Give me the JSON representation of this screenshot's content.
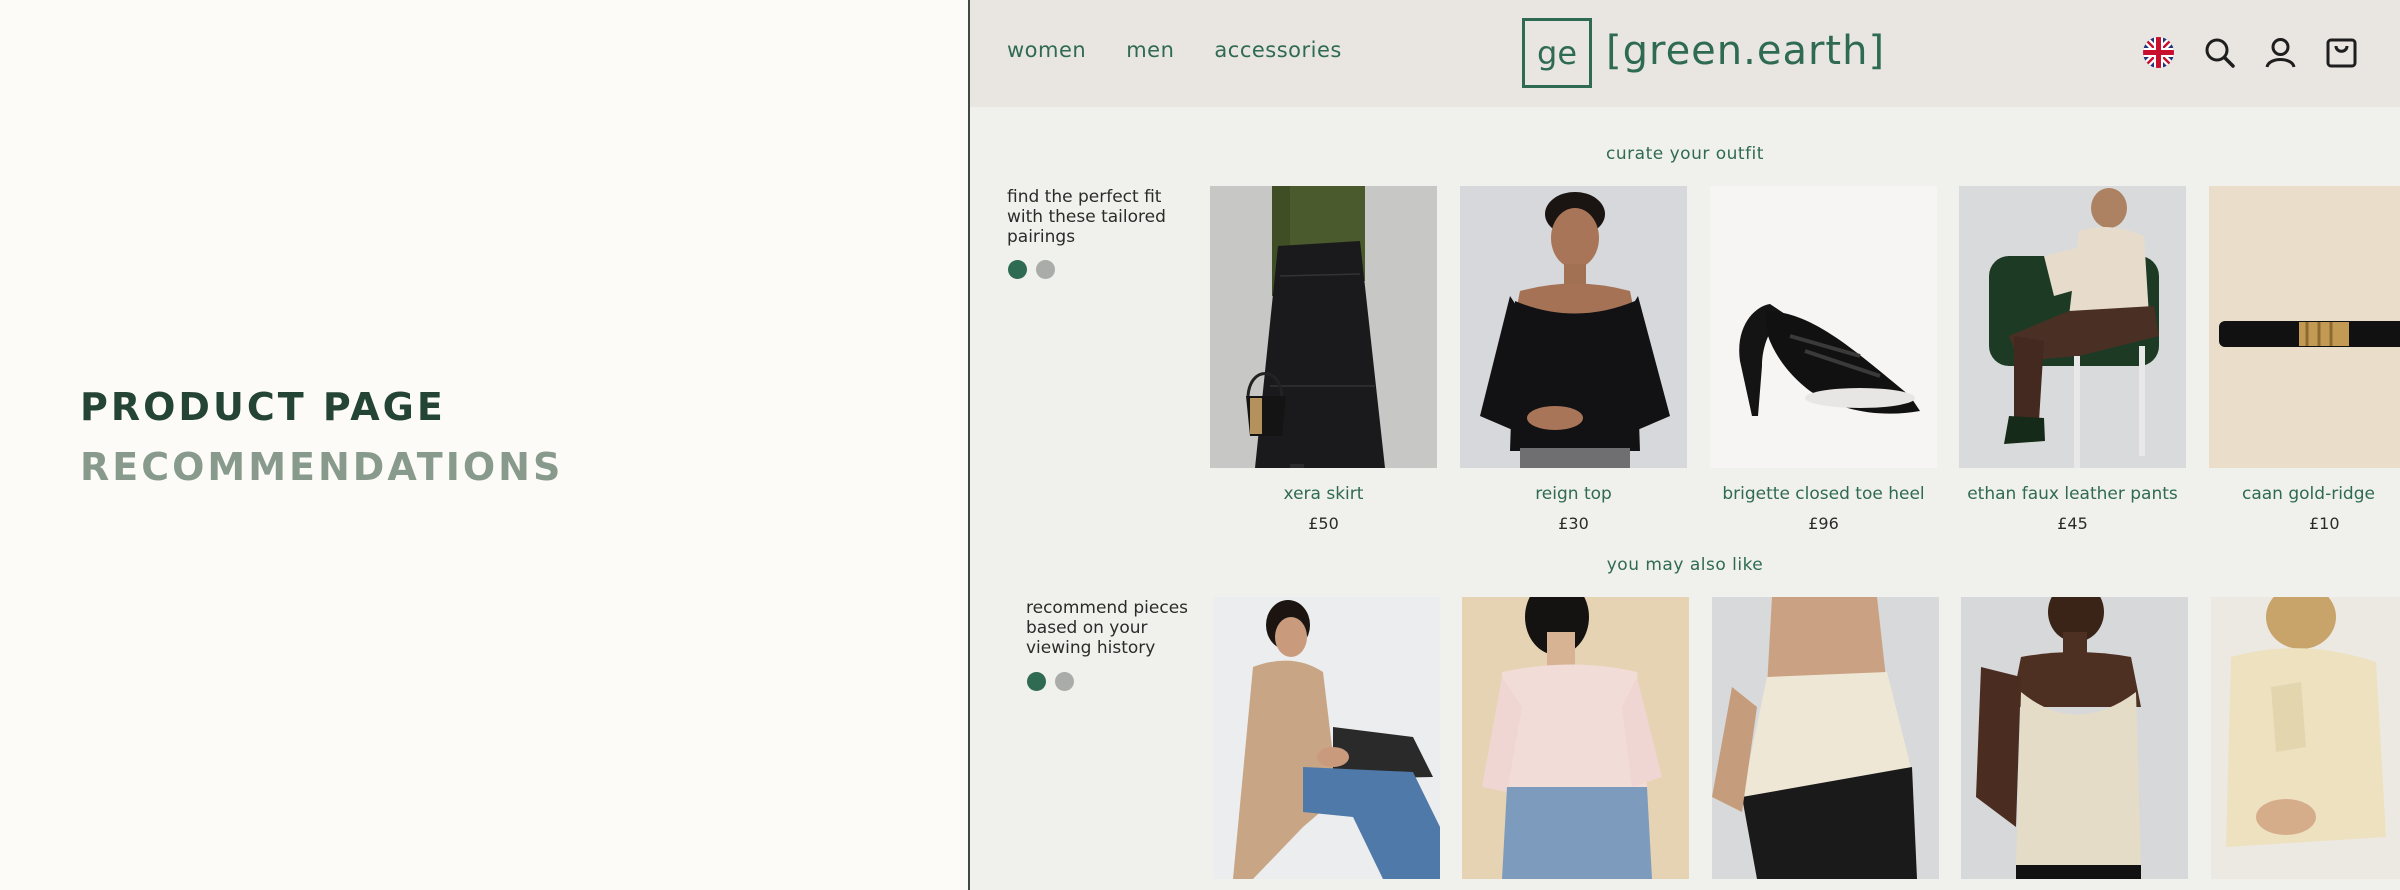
{
  "slide": {
    "title_line1": "PRODUCT PAGE",
    "title_line2": "RECOMMENDATIONS"
  },
  "header": {
    "nav": [
      "women",
      "men",
      "accessories"
    ],
    "logo_mark": "ge",
    "logo_text": "[green.earth]",
    "icons": [
      "uk-flag-icon",
      "search-icon",
      "account-icon",
      "bag-icon"
    ]
  },
  "outfit": {
    "title": "curate your outfit",
    "description": "find the perfect fit with these tailored pairings",
    "products": [
      {
        "name": "xera skirt",
        "price": "£50"
      },
      {
        "name": "reign top",
        "price": "£30"
      },
      {
        "name": "brigette closed toe heel",
        "price": "£96"
      },
      {
        "name": "ethan faux leather pants",
        "price": "£45"
      },
      {
        "name": "caan gold-ridge",
        "price": "£10"
      }
    ]
  },
  "also_like": {
    "title": "you may also like",
    "description": "recommend pieces based on your viewing history"
  },
  "colors": {
    "brand_green": "#2f6a53",
    "title_dark": "#244536",
    "title_muted": "#879a8c"
  }
}
